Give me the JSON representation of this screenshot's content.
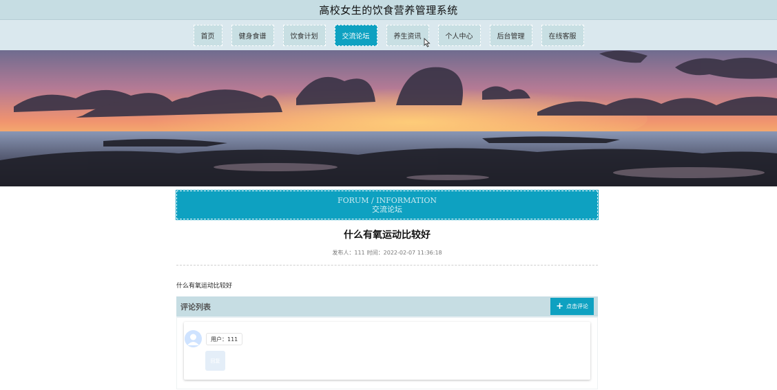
{
  "site": {
    "title": "高校女生的饮食营养管理系统"
  },
  "nav": {
    "items": [
      {
        "label": "首页"
      },
      {
        "label": "健身食谱"
      },
      {
        "label": "饮食计划"
      },
      {
        "label": "交流论坛",
        "active": true
      },
      {
        "label": "养生资讯"
      },
      {
        "label": "个人中心"
      },
      {
        "label": "后台管理"
      },
      {
        "label": "在线客服"
      }
    ]
  },
  "section": {
    "en": "FORUM / INFORMATION",
    "cn": "交流论坛"
  },
  "post": {
    "title": "什么有氧运动比较好",
    "publisher_label": "发布人：111",
    "time_label": "时间：2022-02-07 11:36:18",
    "body": "什么有氧运动比较好"
  },
  "comments": {
    "title": "评论列表",
    "add_button": "点击评论",
    "items": [
      {
        "user_label": "用户：111",
        "reply_label": "回复"
      }
    ]
  },
  "colors": {
    "accent": "#0ea1c1",
    "header_bg": "#c6dde3",
    "nav_bg": "#dae8ee"
  },
  "icons": {
    "add": "plus-icon",
    "avatar": "user-avatar-icon",
    "cursor": "mouse-cursor-icon"
  }
}
